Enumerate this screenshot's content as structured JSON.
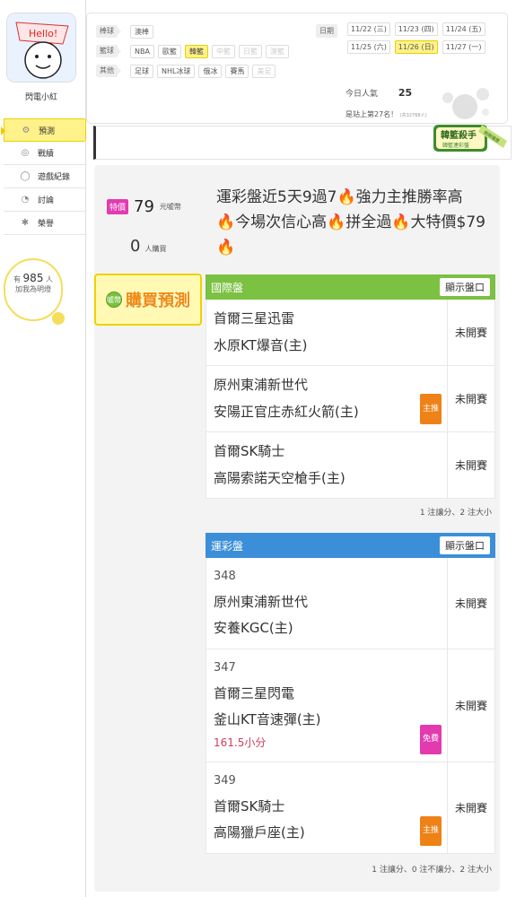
{
  "user": {
    "name": "閃電小紅",
    "avatar_text": "Hello!",
    "fans_prefix": "有",
    "fans_count": "985",
    "fans_suffix": "人",
    "fans_caption": "加我為明燈"
  },
  "nav": [
    {
      "label": "預測",
      "icon": "target-icon",
      "active": true
    },
    {
      "label": "戰績",
      "icon": "trophy-icon",
      "active": false
    },
    {
      "label": "遊戲紀錄",
      "icon": "record-icon",
      "active": false
    },
    {
      "label": "討論",
      "icon": "chat-icon",
      "active": false
    },
    {
      "label": "榮譽",
      "icon": "medal-icon",
      "active": false
    }
  ],
  "filters": {
    "rows": [
      {
        "label": "棒球",
        "items": [
          {
            "text": "澳棒",
            "state": "normal"
          }
        ]
      },
      {
        "label": "籃球",
        "items": [
          {
            "text": "NBA",
            "state": "normal"
          },
          {
            "text": "歐籃",
            "state": "normal"
          },
          {
            "text": "韓籃",
            "state": "selected"
          },
          {
            "text": "中籃",
            "state": "dim"
          },
          {
            "text": "日籃",
            "state": "dim"
          },
          {
            "text": "澳籃",
            "state": "dim"
          }
        ]
      },
      {
        "label": "其他",
        "items": [
          {
            "text": "足球",
            "state": "normal"
          },
          {
            "text": "NHL冰球",
            "state": "normal"
          },
          {
            "text": "俄冰",
            "state": "normal"
          },
          {
            "text": "賽馬",
            "state": "normal"
          },
          {
            "text": "美足",
            "state": "dim"
          }
        ]
      }
    ],
    "date_label": "日期",
    "dates": [
      {
        "text": "11/22 (三)",
        "selected": false
      },
      {
        "text": "11/23 (四)",
        "selected": false
      },
      {
        "text": "11/24 (五)",
        "selected": false
      },
      {
        "text": "11/25 (六)",
        "selected": false
      },
      {
        "text": "11/26 (日)",
        "selected": true
      },
      {
        "text": "11/27 (一)",
        "selected": false
      }
    ],
    "popularity_label": "今日人氣",
    "popularity_value": "25",
    "rank_text": "是站上第27名！",
    "rank_small": "(共32768人)"
  },
  "badge": {
    "main": "韓籃殺手",
    "sub": "韓籃連彩盤",
    "ribbon": "假期優惠"
  },
  "article": {
    "special_label": "特價",
    "price": "79",
    "price_unit": "元噓幣",
    "buyers": "0",
    "buyers_unit": "人購買",
    "title_parts": [
      "運彩盤近5天9過7",
      "強力主推勝率高",
      "今場次信心高",
      "拼全過",
      "大特價$79"
    ],
    "buy_button": "購買預測",
    "buy_coin": "噓幣"
  },
  "international": {
    "header": "國際盤",
    "toggle": "顯示盤口",
    "games": [
      {
        "team1": "首爾三星迅雷",
        "team2": "水原KT爆音(主)",
        "status": "未開賽",
        "tag": ""
      },
      {
        "team1": "原州東浦新世代",
        "team2": "安陽正官庄赤紅火箭(主)",
        "status": "未開賽",
        "tag": "主推"
      },
      {
        "team1": "首爾SK騎士",
        "team2": "高陽索諾天空槍手(主)",
        "status": "未開賽",
        "tag": ""
      }
    ],
    "summary": "1 注讓分、2 注大小"
  },
  "lottery": {
    "header": "運彩盤",
    "toggle": "顯示盤口",
    "games": [
      {
        "id": "348",
        "team1": "原州東浦新世代",
        "team2": "安養KGC(主)",
        "extra": "",
        "status": "未開賽",
        "tag": ""
      },
      {
        "id": "347",
        "team1": "首爾三星閃電",
        "team2": "釜山KT音速彈(主)",
        "extra": "161.5小分",
        "status": "未開賽",
        "tag": "免費"
      },
      {
        "id": "349",
        "team1": "首爾SK騎士",
        "team2": "高陽獵戶座(主)",
        "extra": "",
        "status": "未開賽",
        "tag": "主推"
      }
    ],
    "summary": "1 注讓分、0 注不讓分、2 注大小"
  }
}
